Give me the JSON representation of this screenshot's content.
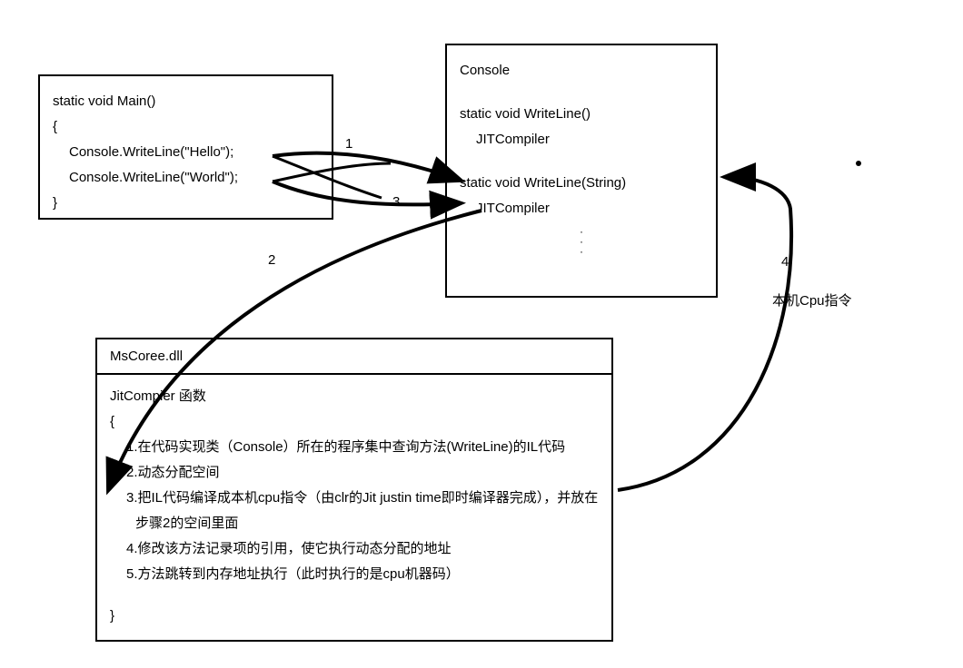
{
  "mainBox": {
    "sig": "static void Main()",
    "open": "{",
    "line1": "Console.WriteLine(\"Hello\");",
    "line2": "Console.WriteLine(\"World\");",
    "close": "}"
  },
  "consoleBox": {
    "title": "Console",
    "method1": "static void WriteLine()",
    "method1sub": "JITCompiler",
    "method2": "static void WriteLine(String)",
    "method2sub": "JITCompiler"
  },
  "mscoreeBox": {
    "header": "MsCoree.dll",
    "func": "JitCompier 函数",
    "open": "{",
    "step1": "1.在代码实现类（Console）所在的程序集中查询方法(WriteLine)的IL代码",
    "step2": "2.动态分配空间",
    "step3": "3.把IL代码编译成本机cpu指令（由clr的Jit justin time即时编译器完成），并放在",
    "step3b": "步骤2的空间里面",
    "step4": "4.修改该方法记录项的引用，使它执行动态分配的地址",
    "step5": "5.方法跳转到内存地址执行（此时执行的是cpu机器码）",
    "close": "}"
  },
  "labels": {
    "l1": "1",
    "l2": "2",
    "l3": "3",
    "l4": "4",
    "caption4": "本机Cpu指令"
  }
}
